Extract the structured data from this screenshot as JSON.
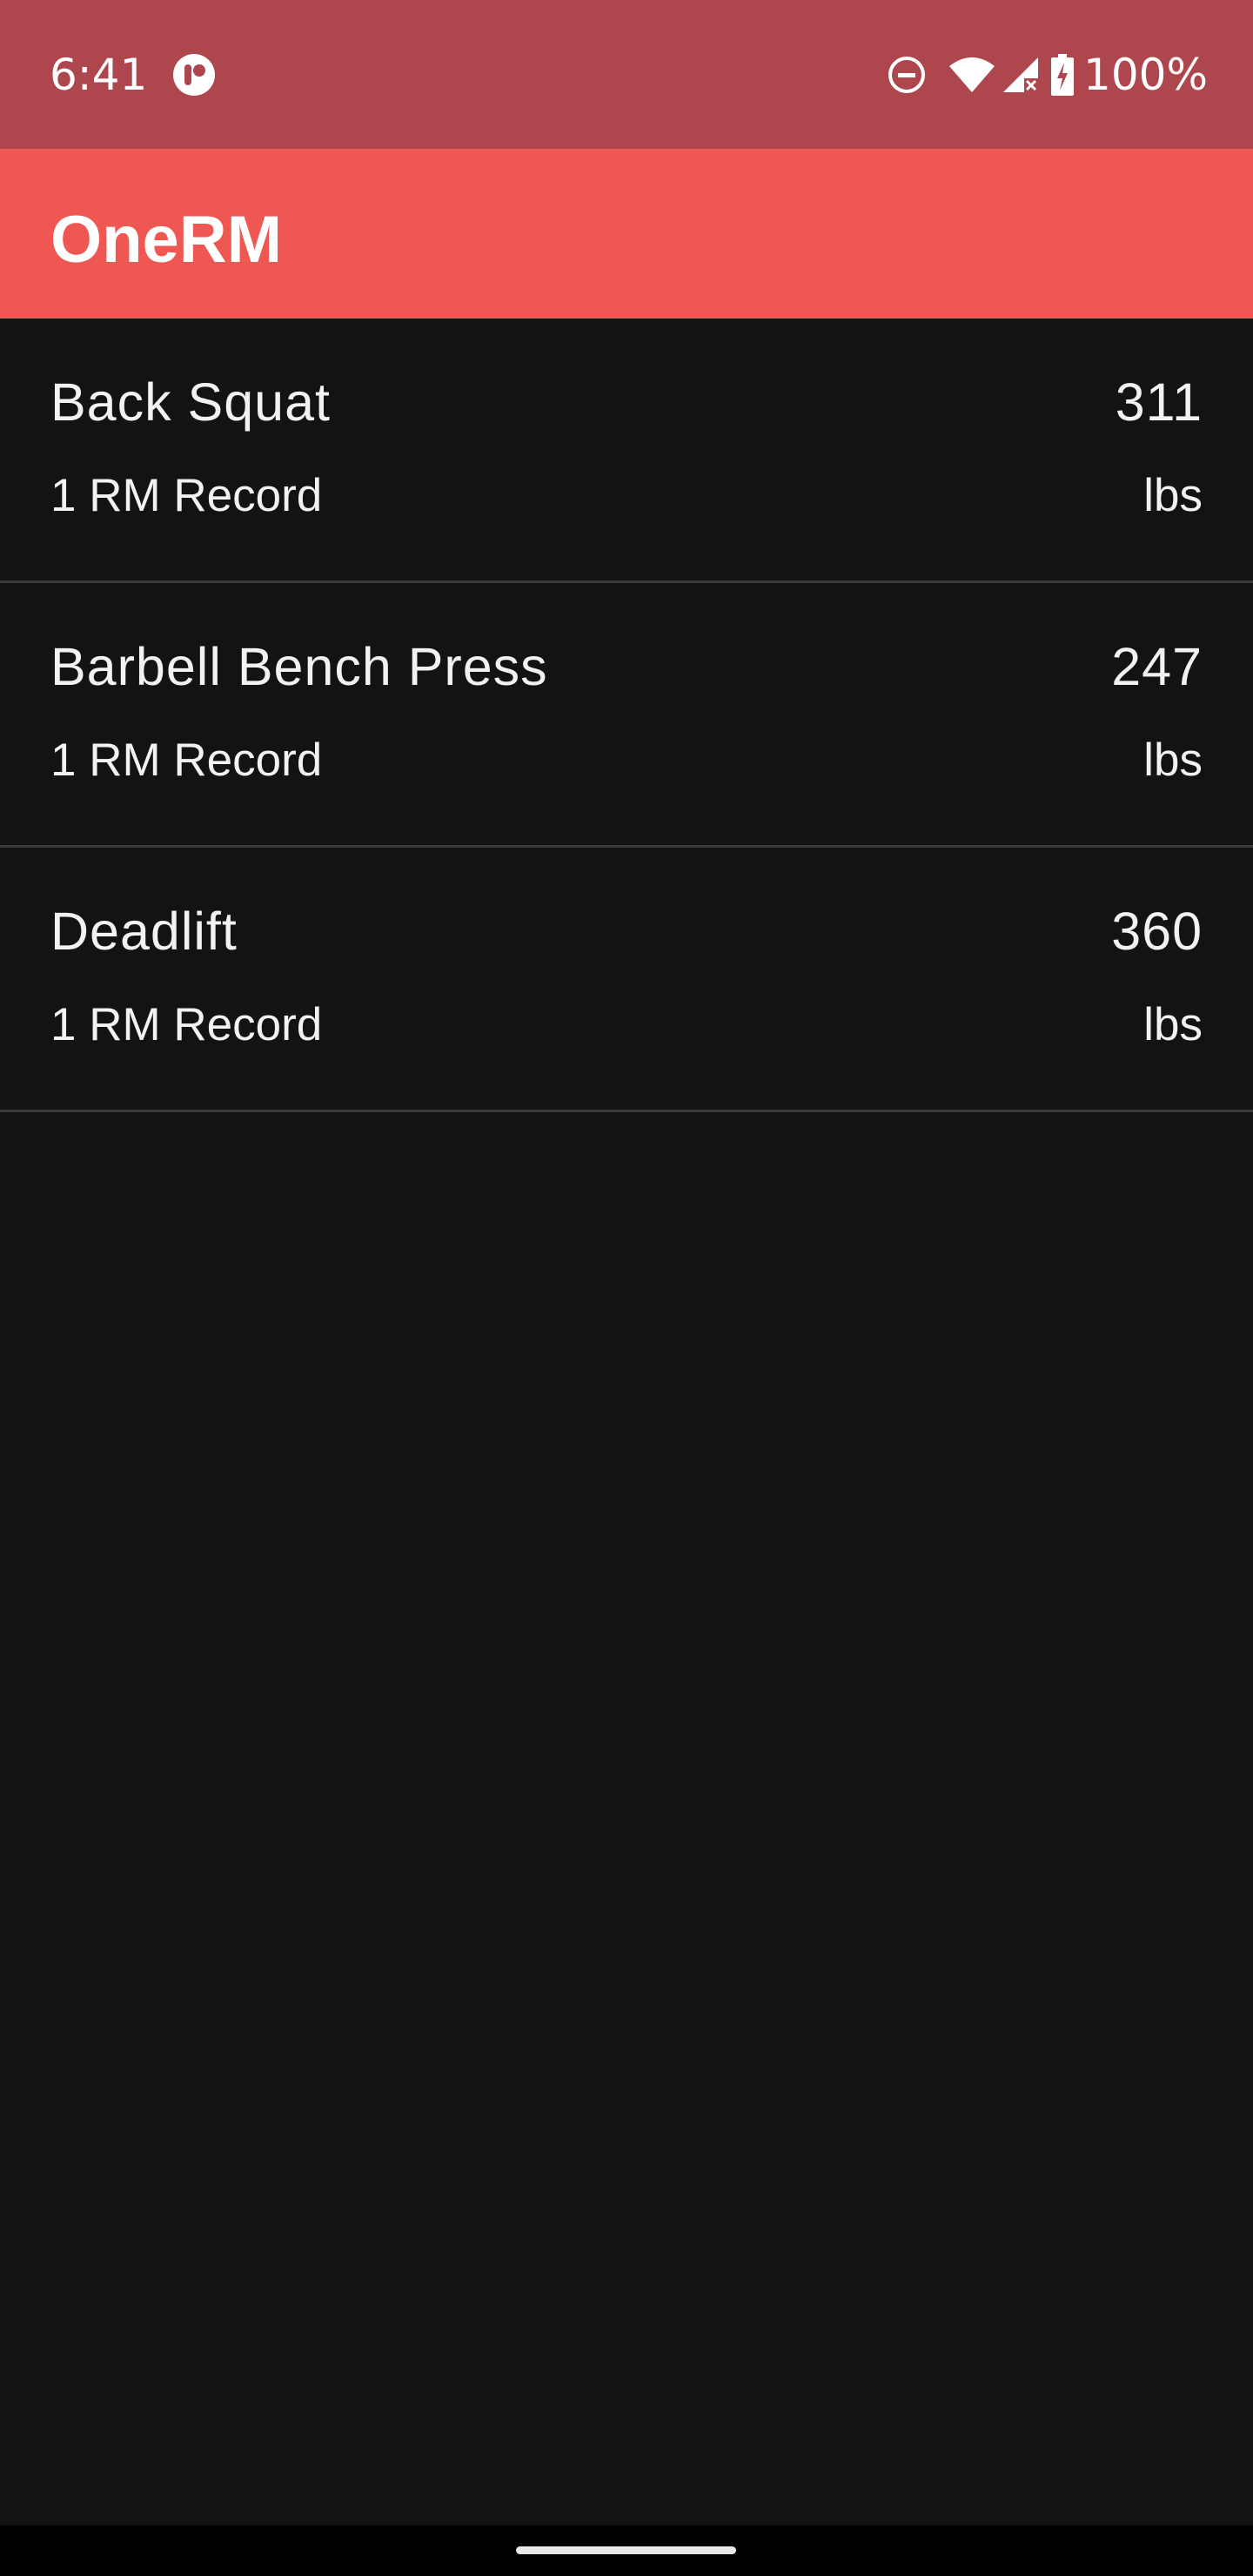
{
  "status_bar": {
    "time": "6:41",
    "battery_text": "100%",
    "icons": [
      "app-notification-icon",
      "do-not-disturb-icon",
      "wifi-icon",
      "cellular-signal-icon",
      "battery-charging-icon"
    ]
  },
  "app_bar": {
    "title": "OneRM"
  },
  "records": [
    {
      "name": "Back Squat",
      "value": "311",
      "subtitle": "1 RM Record",
      "unit": "lbs"
    },
    {
      "name": "Barbell Bench Press",
      "value": "247",
      "subtitle": "1 RM Record",
      "unit": "lbs"
    },
    {
      "name": "Deadlift",
      "value": "360",
      "subtitle": "1 RM Record",
      "unit": "lbs"
    }
  ],
  "colors": {
    "status_bar": "#ad474d",
    "app_bar": "#ef5753",
    "background": "#131313",
    "divider": "#3a3a3a"
  }
}
